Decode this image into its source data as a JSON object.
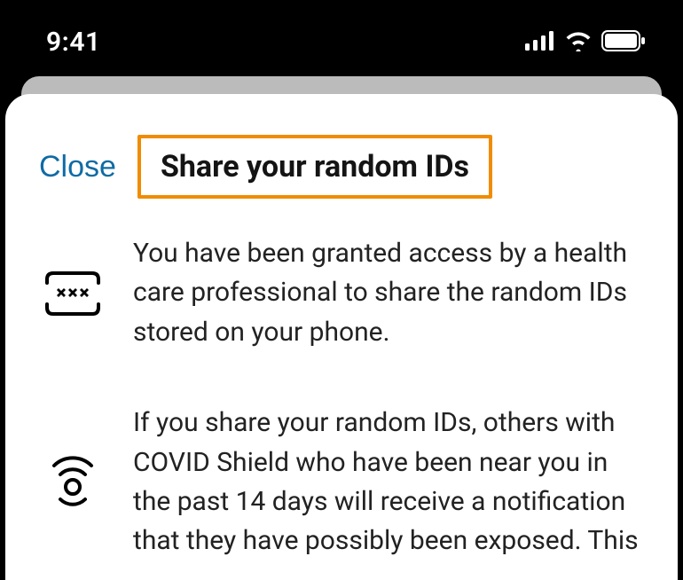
{
  "status": {
    "time": "9:41"
  },
  "sheet": {
    "close_label": "Close",
    "title": "Share your random IDs",
    "paragraph1": "You have been granted access by a health care professional to share the random IDs stored on your phone.",
    "paragraph2": "If you share your random IDs, others with COVID Shield who have been near you in the past 14 days will receive a notification that they have possibly been exposed. This"
  }
}
